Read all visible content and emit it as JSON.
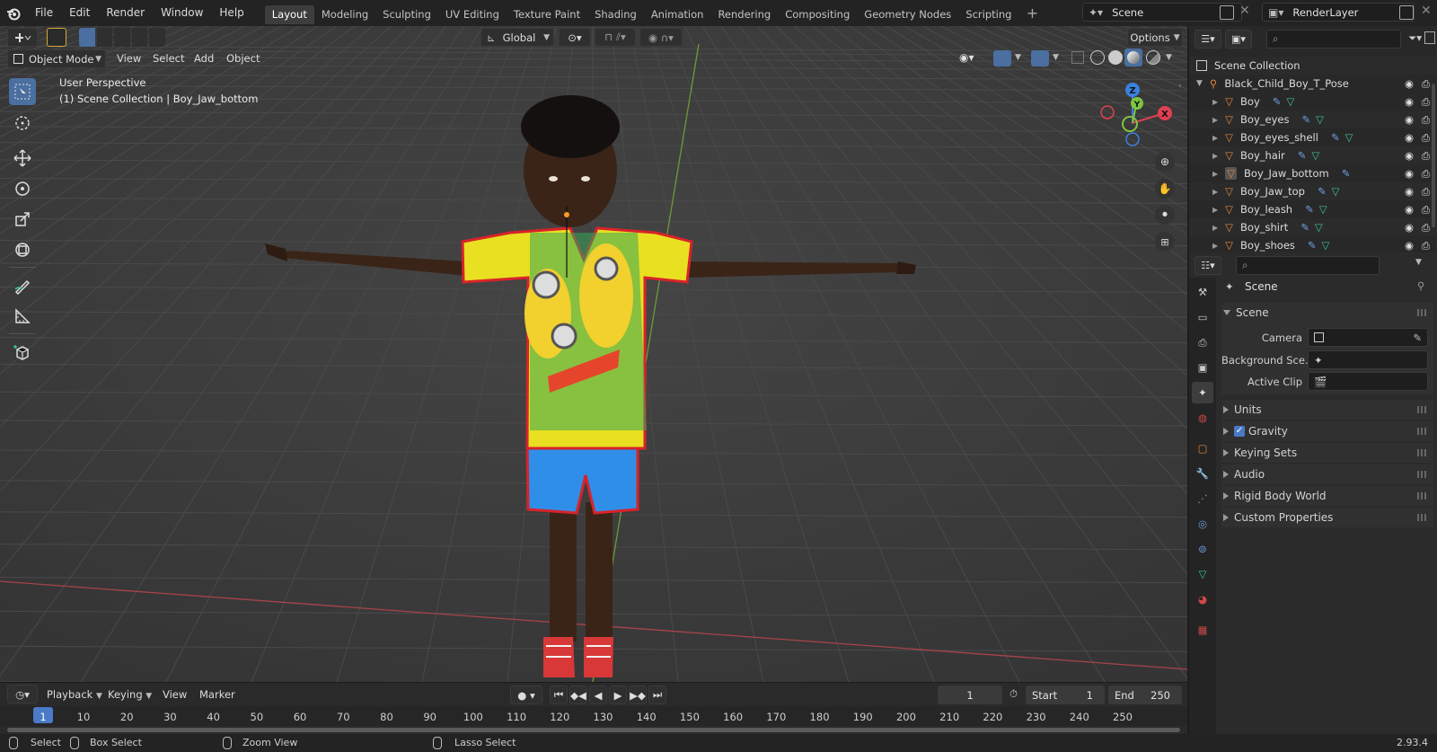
{
  "menus": [
    "File",
    "Edit",
    "Render",
    "Window",
    "Help"
  ],
  "workspaces": [
    "Layout",
    "Modeling",
    "Sculpting",
    "UV Editing",
    "Texture Paint",
    "Shading",
    "Animation",
    "Rendering",
    "Compositing",
    "Geometry Nodes",
    "Scripting"
  ],
  "scene_name": "Scene",
  "view_layer": "RenderLayer",
  "viewport": {
    "orientation": "Global",
    "options_label": "Options",
    "mode": "Object Mode",
    "header_menus": [
      "View",
      "Select",
      "Add",
      "Object"
    ],
    "overlay_line1": "User Perspective",
    "overlay_line2": "(1) Scene Collection | Boy_Jaw_bottom",
    "gizmo_axes": {
      "x": "X",
      "y": "Y",
      "z": "Z"
    }
  },
  "outliner": {
    "root": "Scene Collection",
    "collection": "Black_Child_Boy_T_Pose",
    "objects": [
      "Boy",
      "Boy_eyes",
      "Boy_eyes_shell",
      "Boy_hair",
      "Boy_Jaw_bottom",
      "Boy_Jaw_top",
      "Boy_leash",
      "Boy_shirt",
      "Boy_shoes"
    ]
  },
  "properties": {
    "context_title": "Scene",
    "panel_title": "Scene",
    "camera_label": "Camera",
    "background_label": "Background Sce...",
    "active_clip_label": "Active Clip",
    "collapsed_panels": [
      "Units",
      "Gravity",
      "Keying Sets",
      "Audio",
      "Rigid Body World",
      "Custom Properties"
    ]
  },
  "timeline": {
    "menus": [
      "Playback",
      "Keying",
      "View",
      "Marker"
    ],
    "current_frame": "1",
    "start_label": "Start",
    "start": "1",
    "end_label": "End",
    "end": "250",
    "ticks": [
      "1",
      "10",
      "20",
      "30",
      "40",
      "50",
      "60",
      "70",
      "80",
      "90",
      "100",
      "110",
      "120",
      "130",
      "140",
      "150",
      "160",
      "170",
      "180",
      "190",
      "200",
      "210",
      "220",
      "230",
      "240",
      "250"
    ]
  },
  "status": {
    "select": "Select",
    "box_select": "Box Select",
    "zoom_view": "Zoom View",
    "lasso_select": "Lasso Select",
    "version": "2.93.4"
  },
  "colors": {
    "accent": "#4a6fa0",
    "object_orange": "#e8883a",
    "modifier_blue": "#6d9ee0",
    "mesh_green": "#3ec29a",
    "axis_x": "#e04050",
    "axis_y": "#7ec440",
    "axis_z": "#3a80e0"
  }
}
